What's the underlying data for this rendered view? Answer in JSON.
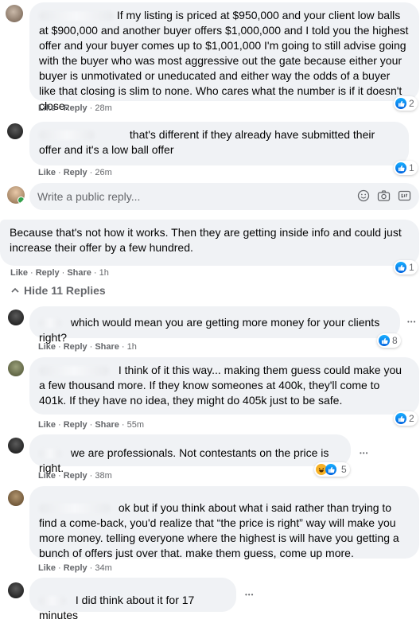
{
  "comments": [
    {
      "text": "If my listing is priced at $950,000 and your client low balls at $900,000 and another buyer offers $1,000,000 and I told you the highest offer and your buyer comes up to $1,001,000 I'm going to still advise going with the buyer who was most aggressive out the gate because either your buyer is unmotivated or uneducated and either way the odds of a buyer like that closing is slim to none. Who cares what the number is if it doesn't close.",
      "like": "Like",
      "reply": "Reply",
      "time": "28m",
      "reaction_count": "2"
    },
    {
      "text": "that's different if they already have submitted their offer and it's a low ball offer",
      "like": "Like",
      "reply": "Reply",
      "time": "26m",
      "reaction_count": "1"
    },
    {
      "text": "Because that's not how it works. Then they are getting inside info and could just increase their offer by a few hundred.",
      "like": "Like",
      "reply": "Reply",
      "share": "Share",
      "time": "1h",
      "reaction_count": "1"
    },
    {
      "text": "which would mean you are getting more money for your clients right?",
      "like": "Like",
      "reply": "Reply",
      "share": "Share",
      "time": "1h",
      "reaction_count": "8"
    },
    {
      "text": "I think of it this way... making them guess could make you a few thousand more. If they know someones at 400k, they'll come to 401k. If they have no idea, they might do 405k just to be safe.",
      "like": "Like",
      "reply": "Reply",
      "share": "Share",
      "time": "55m",
      "reaction_count": "2"
    },
    {
      "text": "we are professionals. Not contestants on the price is right.",
      "like": "Like",
      "reply": "Reply",
      "time": "38m",
      "reaction_count": "5"
    },
    {
      "text": "ok but if you think about what i said rather than trying to find a come-back, you'd realize that “the price is right” way will make you more money. telling everyone where the highest is will have you getting a bunch of offers just over that. make them guess, come up more.",
      "like": "Like",
      "reply": "Reply",
      "time": "34m"
    },
    {
      "text": "I did think about it for 17 minutes"
    }
  ],
  "reply_box": {
    "placeholder": "Write a public reply..."
  },
  "hide_replies": "Hide 11 Replies",
  "more_glyph": "•••",
  "dot": "·",
  "icons": [
    "like-icon",
    "haha-icon",
    "emoji-icon",
    "camera-icon",
    "gif-icon",
    "chevron-up-icon"
  ],
  "colors": {
    "bubble": "#f0f2f5",
    "meta": "#65676b",
    "like_blue": "#1877f2"
  }
}
